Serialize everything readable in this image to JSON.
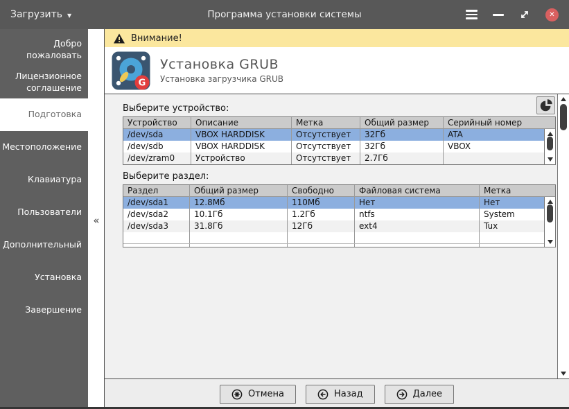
{
  "window": {
    "load_button": "Загрузить",
    "title": "Программа установки системы"
  },
  "icons": {
    "dropdown_caret": "▼",
    "close_glyph": "✕",
    "collapse_glyph": "«"
  },
  "sidebar": {
    "items": [
      {
        "label": "Добро пожаловать",
        "active": false
      },
      {
        "label": "Лицензионное соглашение",
        "active": false
      },
      {
        "label": "Подготовка",
        "active": true
      },
      {
        "label": "Местоположение",
        "active": false
      },
      {
        "label": "Клавиатура",
        "active": false
      },
      {
        "label": "Пользователи",
        "active": false
      },
      {
        "label": "Дополнительный",
        "active": false
      },
      {
        "label": "Установка",
        "active": false
      },
      {
        "label": "Завершение",
        "active": false
      }
    ]
  },
  "banner": {
    "text": "Внимание!"
  },
  "header": {
    "title": "Установка GRUB",
    "subtitle": "Установка загрузчика GRUB",
    "badge_letter": "G"
  },
  "device_section": {
    "label": "Выберите устройство:",
    "columns": [
      "Устройство",
      "Описание",
      "Метка",
      "Общий размер",
      "Серийный номер"
    ],
    "rows": [
      [
        "/dev/sda",
        "VBOX HARDDISK",
        "Отсутствует",
        "32Гб",
        "ATA"
      ],
      [
        "/dev/sdb",
        "VBOX HARDDISK",
        "Отсутствует",
        "32Гб",
        "VBOX"
      ],
      [
        "/dev/zram0",
        "Устройство",
        "Отсутствует",
        "2.7Гб",
        ""
      ]
    ],
    "selected_index": 0
  },
  "partition_section": {
    "label": "Выберите раздел:",
    "columns": [
      "Раздел",
      "Общий размер",
      "Свободно",
      "Файловая система",
      "Метка"
    ],
    "rows": [
      [
        "/dev/sda1",
        "12.8Мб",
        "110Мб",
        "Нет",
        "Нет"
      ],
      [
        "/dev/sda2",
        "10.1Гб",
        "1.2Гб",
        "ntfs",
        "System"
      ],
      [
        "/dev/sda3",
        "31.8Гб",
        "12Гб",
        "ext4",
        "Tux"
      ]
    ],
    "selected_index": 0
  },
  "footer": {
    "cancel_label": "Отмена",
    "back_label": "Назад",
    "next_label": "Далее"
  },
  "colors": {
    "titlebar": "#585858",
    "sidebar": "#5f5f5f",
    "selection_blue": "#8cafdf",
    "warning_yellow": "#fbe79e",
    "close_red": "#d96060",
    "table_header": "#cbcbcb",
    "panel_bg": "#f1f1f1"
  }
}
